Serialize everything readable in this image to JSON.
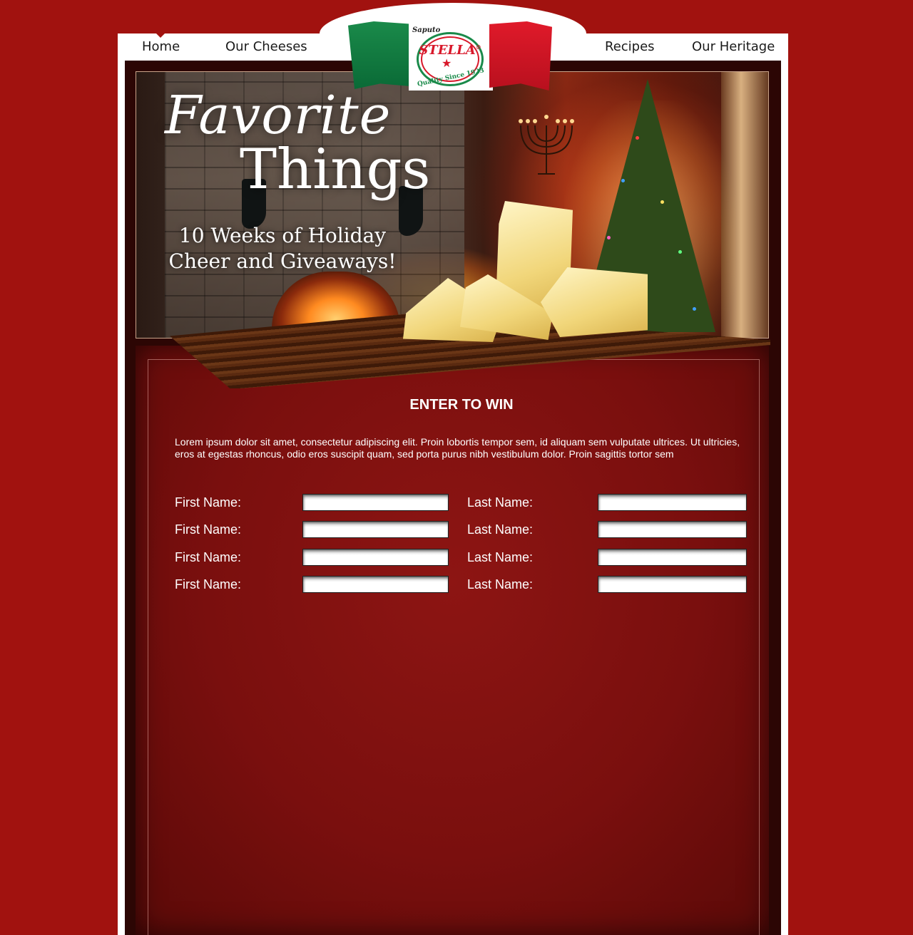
{
  "nav": {
    "home": "Home",
    "cheeses": "Our Cheeses",
    "recipes": "Recipes",
    "heritage": "Our Heritage"
  },
  "logo": {
    "brand": "Saputo",
    "name": "STELLA",
    "registered": "®",
    "tagline": "Quality Since 1923",
    "star": "★"
  },
  "hero": {
    "title_line1": "Favorite",
    "title_line2": "Things",
    "subtitle": "10 Weeks of Holiday Cheer and Giveaways!"
  },
  "form": {
    "title": "ENTER TO WIN",
    "intro": "Lorem ipsum dolor sit amet, consectetur adipiscing elit. Proin lobortis tempor sem, id aliquam sem vulputate ultrices. Ut ultricies, eros at egestas rhoncus, odio eros suscipit quam, sed porta purus nibh vestibulum dolor. Proin sagittis tortor sem",
    "rows": [
      {
        "first_label": "First Name:",
        "last_label": "Last Name:",
        "first_value": "",
        "last_value": ""
      },
      {
        "first_label": "First Name:",
        "last_label": "Last Name:",
        "first_value": "",
        "last_value": ""
      },
      {
        "first_label": "First Name:",
        "last_label": "Last Name:",
        "first_value": "",
        "last_value": ""
      },
      {
        "first_label": "First Name:",
        "last_label": "Last Name:",
        "first_value": "",
        "last_value": ""
      }
    ]
  },
  "colors": {
    "background": "#a1120f",
    "frame": "#2c0604",
    "panel": "#7a0f0e",
    "flag_green": "#1a8a4a",
    "flag_red": "#d8182a"
  }
}
